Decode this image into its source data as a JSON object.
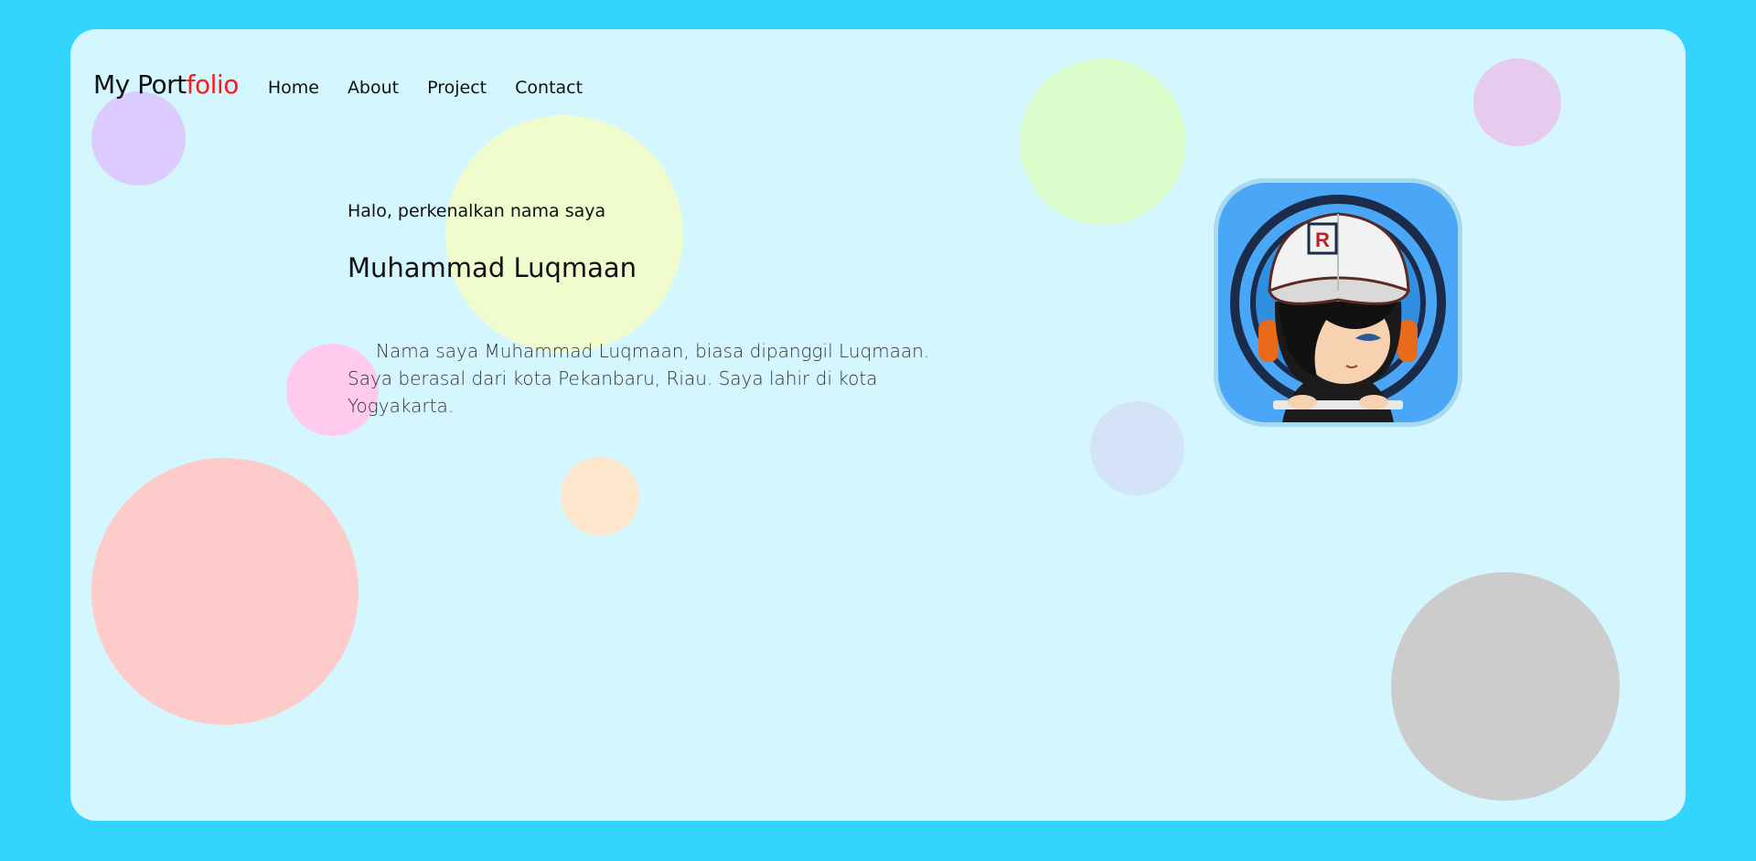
{
  "nav": {
    "logo_main": "My Port",
    "logo_accent": "folio",
    "links": [
      "Home",
      "About",
      "Project",
      "Contact"
    ]
  },
  "hero": {
    "greeting": "Halo, perkenalkan nama saya",
    "name": "Muhammad Luqmaan",
    "bio": "Nama saya Muhammad Luqmaan, biasa dipanggil Luqmaan. Saya berasal dari kota Pekanbaru, Riau. Saya lahir di kota Yogyakarta."
  },
  "avatar": {
    "cap_logo": "R",
    "image": "avatar-illustration"
  },
  "colors": {
    "page_background": "#33d5ff",
    "card_background": "#d4f6fe",
    "logo_accent": "#ff1a1a"
  }
}
